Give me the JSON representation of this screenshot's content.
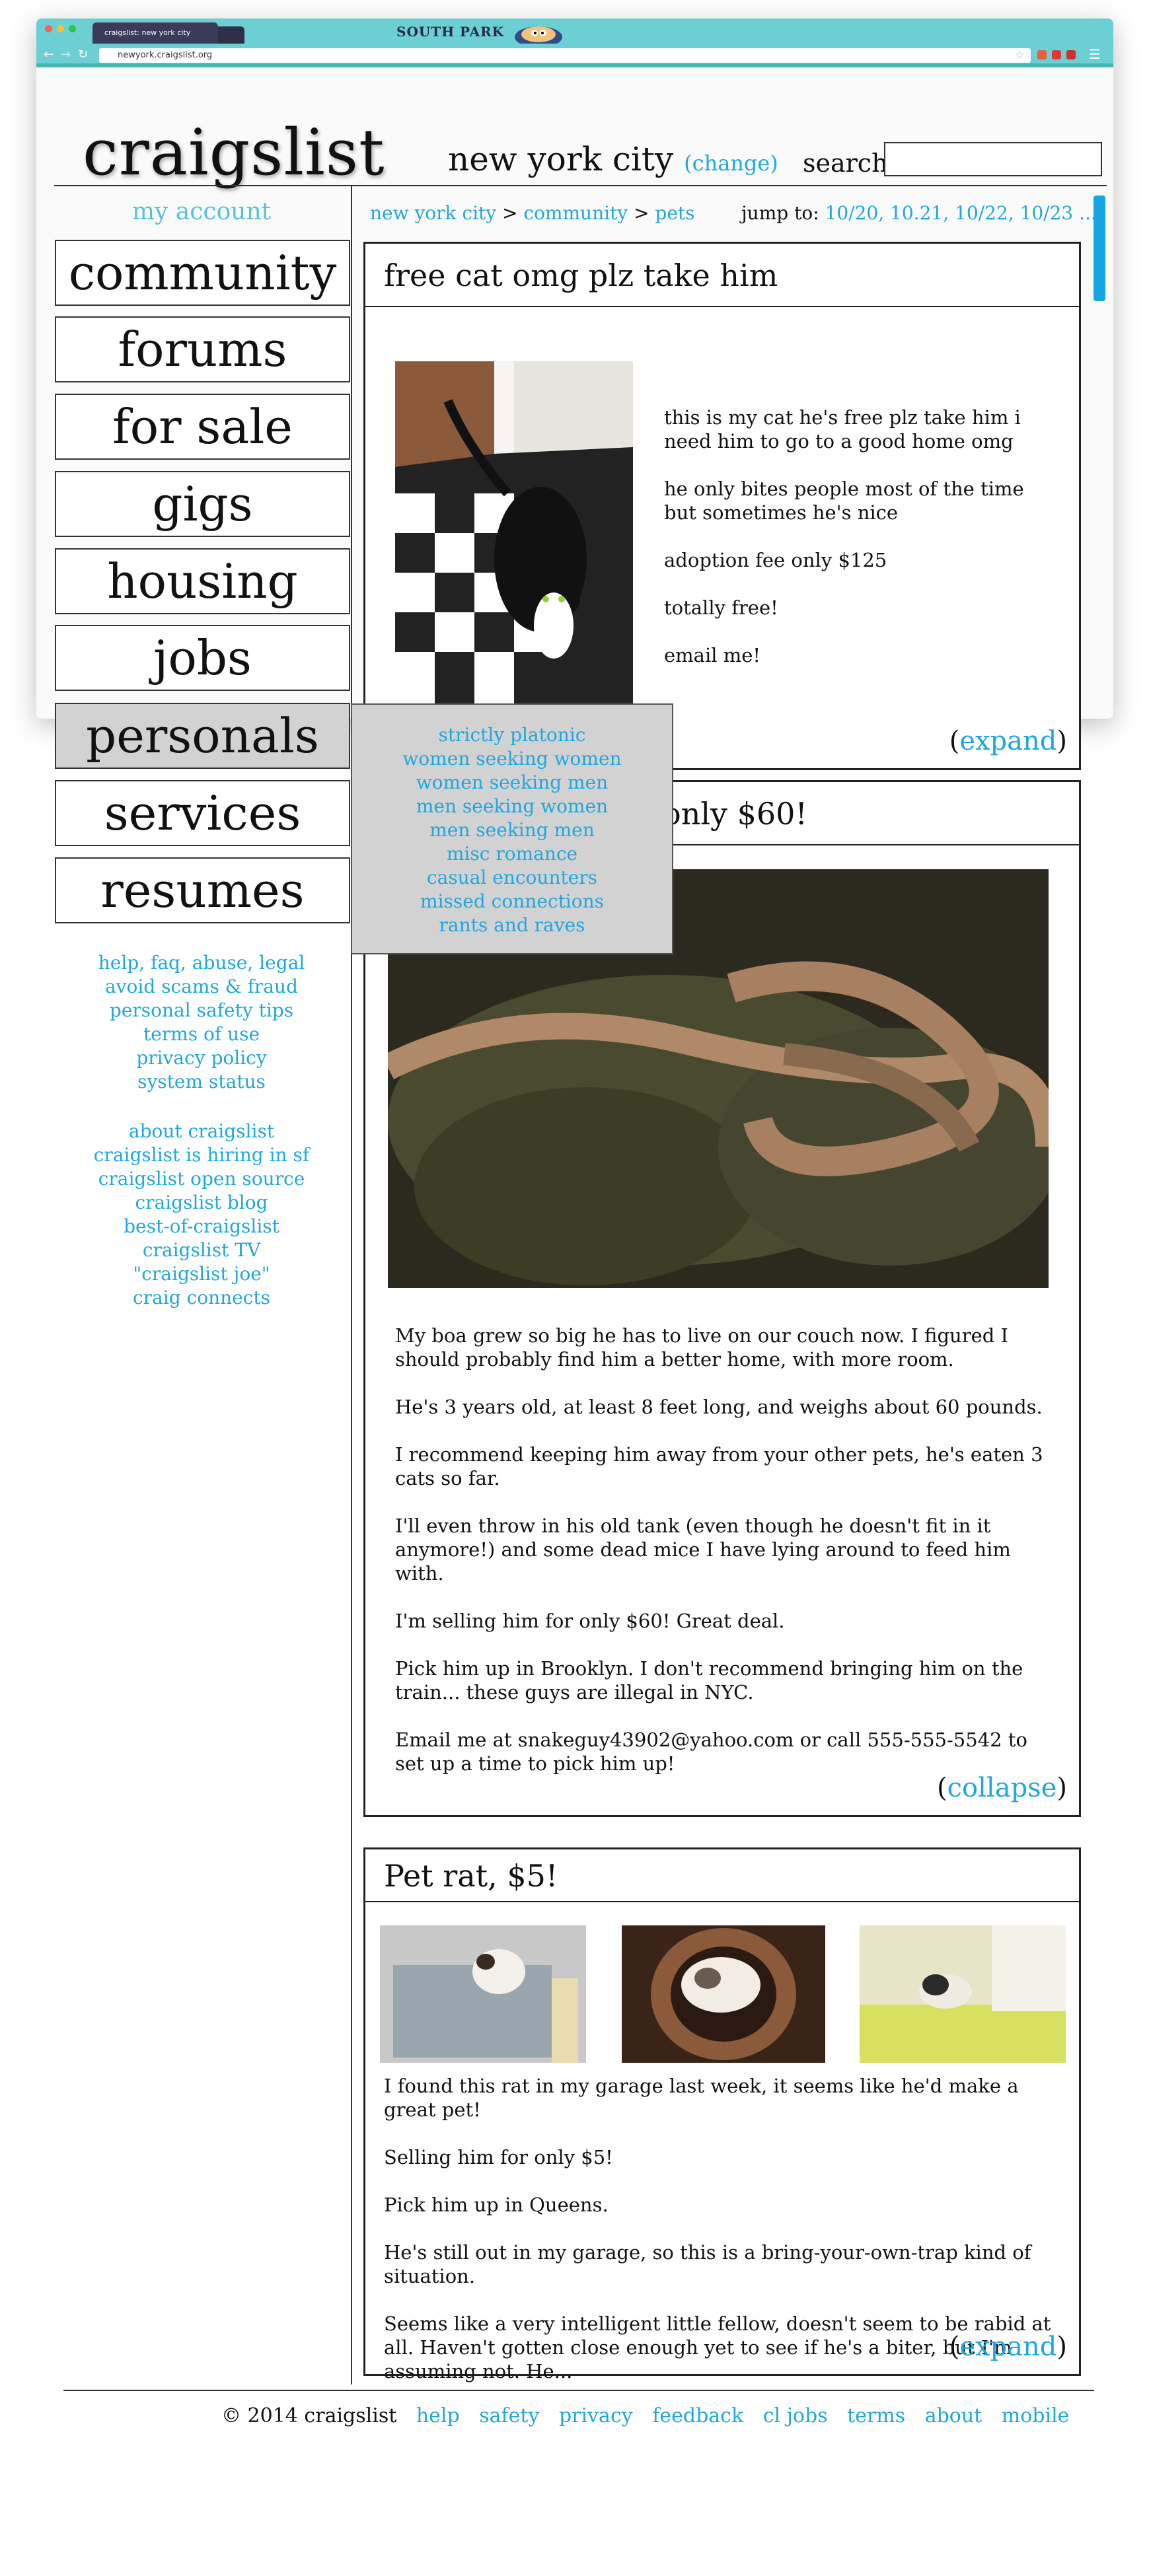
{
  "browser": {
    "tab_title": "craigslist: new york city",
    "url": "newyork.craigslist.org",
    "brand_banner": "SOUTH PARK"
  },
  "header": {
    "logo": "craigslist",
    "city": "new york city",
    "change_open": "(",
    "change_link": "change",
    "change_close": ")",
    "search_label": "search"
  },
  "sidebar": {
    "my_account": "my account",
    "categories": [
      "community",
      "forums",
      "for sale",
      "gigs",
      "housing",
      "jobs",
      "personals",
      "services",
      "resumes"
    ],
    "help_links": [
      "help, faq, abuse, legal",
      "avoid scams & fraud",
      "personal safety tips",
      "terms of use",
      "privacy policy",
      "system status"
    ],
    "about_links": [
      "about craigslist",
      "craigslist is hiring in sf",
      "craigslist open source",
      "craigslist blog",
      "best-of-craigslist",
      "craigslist TV",
      "\"craigslist joe\"",
      "craig connects"
    ]
  },
  "personals_menu": [
    "strictly platonic",
    "women seeking women",
    "women seeking men",
    "men seeking women",
    "men seeking men",
    "misc romance",
    "casual encounters",
    "missed connections",
    "rants and raves"
  ],
  "breadcrumb": {
    "items": [
      "new york city",
      "community",
      "pets"
    ],
    "separator": ">"
  },
  "jump": {
    "label": "jump to:",
    "dates": [
      "10/20,",
      "10.21,",
      "10/22,",
      "10/23 ..."
    ]
  },
  "posts": [
    {
      "title": "free cat omg plz take him",
      "paragraphs": [
        "this is my cat he's free plz take him i need him to go to a good home omg",
        "he only bites people most of the time but sometimes he's nice",
        "adoption fee only $125",
        "totally free!",
        "email me!"
      ],
      "toggle": "expand"
    },
    {
      "title_visible": "only $60!",
      "paragraphs": [
        "My boa grew so big he has to live on our couch now. I figured I should probably find him a better home, with more room.",
        "He's 3 years old, at least 8 feet long, and weighs about 60 pounds.",
        "I recommend keeping him away from your other pets, he's eaten 3 cats so far.",
        "I'll even throw in his old tank (even though he doesn't fit in it anymore!) and some dead mice I have lying around to feed him with.",
        "I'm selling him for only $60! Great deal.",
        "Pick him up in Brooklyn. I don't recommend bringing him on the train... these guys are illegal in NYC.",
        "Email me at snakeguy43902@yahoo.com or call 555-555-5542 to set up a time to pick him up!"
      ],
      "toggle": "collapse"
    },
    {
      "title": "Pet rat, $5!",
      "paragraphs": [
        "I found this rat in my garage last week, it seems like he'd make a great pet!",
        "Selling him for only $5!",
        "Pick him up in Queens.",
        "He's still out in my garage, so this is a bring-your-own-trap kind of situation.",
        "Seems like a very intelligent little fellow, doesn't seem to be rabid at all. Haven't gotten close enough yet to see if he's a biter, but I'm assuming not. He..."
      ],
      "toggle": "expand"
    }
  ],
  "footer": {
    "copyright": "© 2014 craigslist",
    "links": [
      "help",
      "safety",
      "privacy",
      "feedback",
      "cl jobs",
      "terms",
      "about",
      "mobile"
    ]
  },
  "colors": {
    "link": "#1fa7e0",
    "browser_chrome": "#6ccfd3",
    "selected_category": "#d2d2d2"
  }
}
